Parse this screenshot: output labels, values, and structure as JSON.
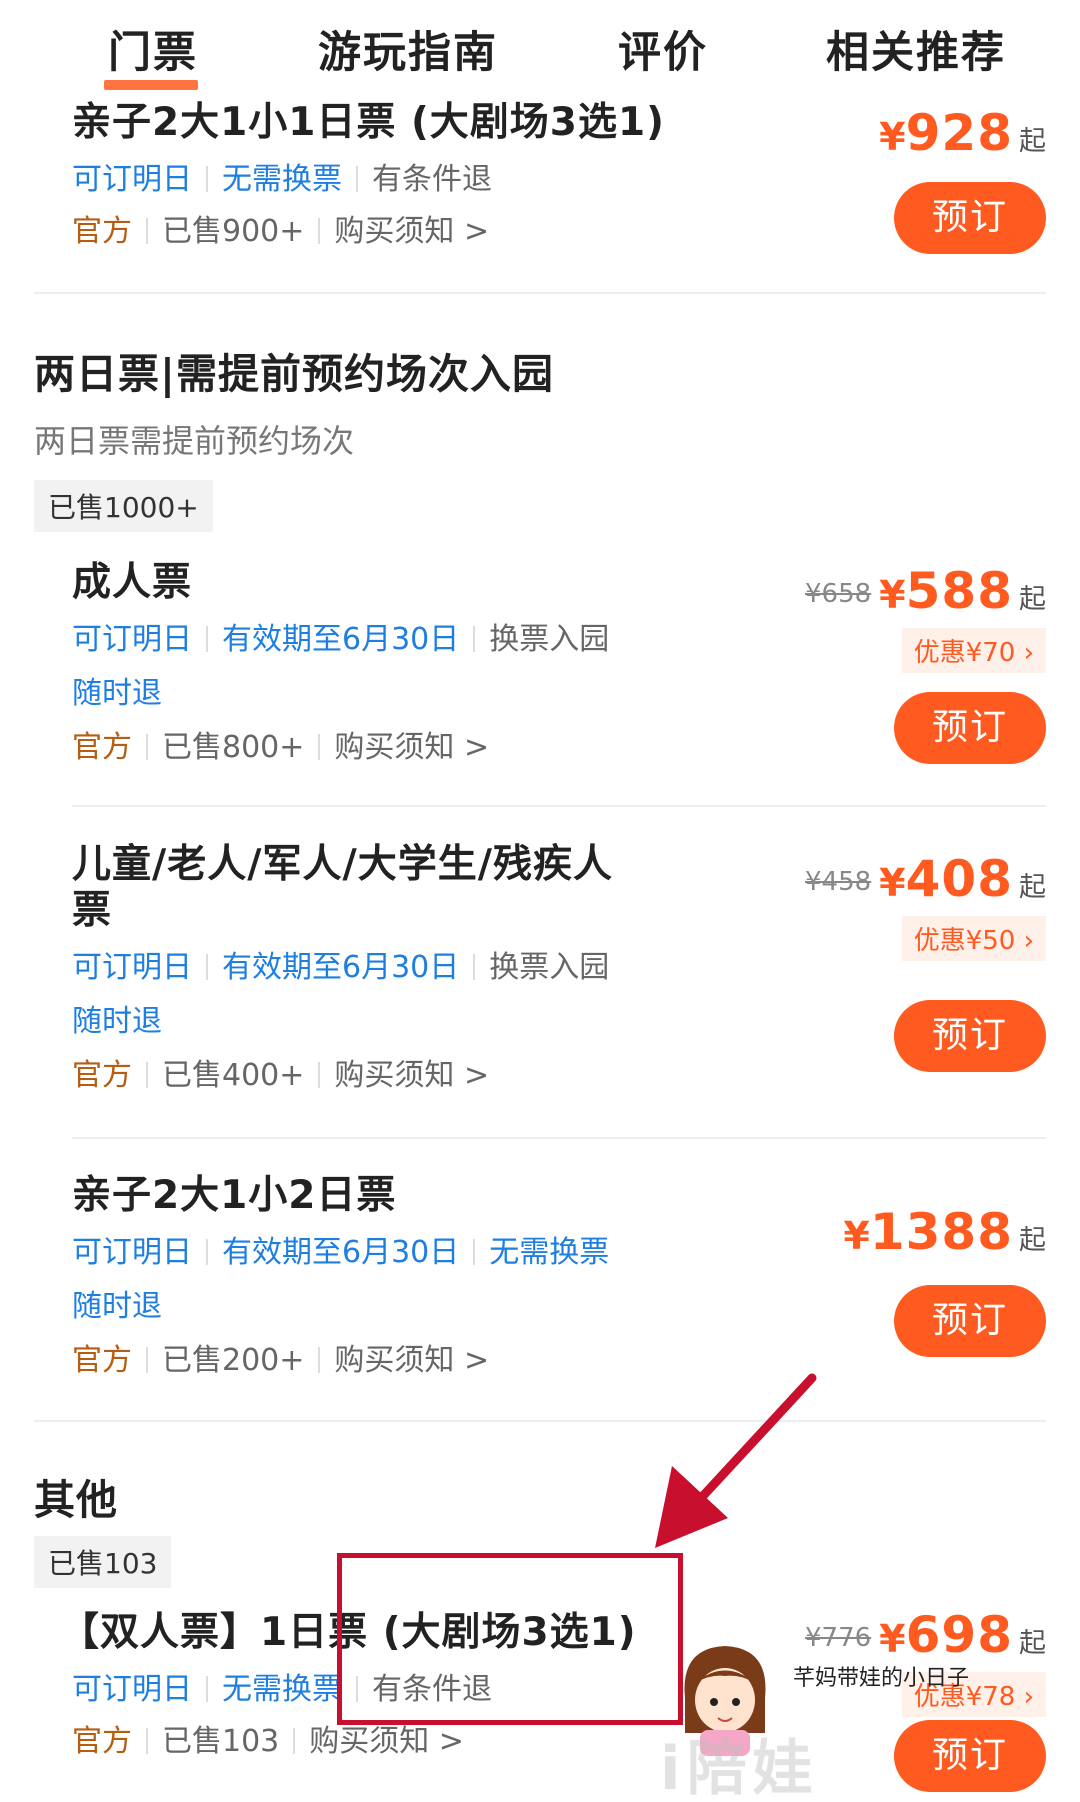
{
  "tabs": [
    {
      "label": "门票",
      "active": true
    },
    {
      "label": "游玩指南",
      "active": false
    },
    {
      "label": "评价",
      "active": false
    },
    {
      "label": "相关推荐",
      "active": false
    }
  ],
  "ticket1": {
    "name": "亲子2大1小1日票 (大剧场3选1)",
    "tags": [
      "可订明日",
      "无需换票",
      "有条件退"
    ],
    "meta": [
      "官方",
      "已售900+",
      "购买须知 >"
    ],
    "currency": "¥",
    "price": "928",
    "price_suffix": "起",
    "button": "预订"
  },
  "group_two_day": {
    "title": "两日票|需提前预约场次入园",
    "subtitle": "两日票需提前预约场次",
    "sold": "已售1000+"
  },
  "ticket2": {
    "name": "成人票",
    "tags": [
      "可订明日",
      "有效期至6月30日",
      "换票入园"
    ],
    "tag_line2": "随时退",
    "meta": [
      "官方",
      "已售800+",
      "购买须知 >"
    ],
    "orig_price": "¥658",
    "currency": "¥",
    "price": "588",
    "price_suffix": "起",
    "discount": "优惠¥70 ›",
    "button": "预订"
  },
  "ticket3": {
    "name_line1": "儿童/老人/军人/大学生/残疾人",
    "name_line2": "票",
    "tags": [
      "可订明日",
      "有效期至6月30日",
      "换票入园"
    ],
    "tag_line2": "随时退",
    "meta": [
      "官方",
      "已售400+",
      "购买须知 >"
    ],
    "orig_price": "¥458",
    "currency": "¥",
    "price": "408",
    "price_suffix": "起",
    "discount": "优惠¥50 ›",
    "button": "预订"
  },
  "ticket4": {
    "name": "亲子2大1小2日票",
    "tags": [
      "可订明日",
      "有效期至6月30日",
      "无需换票"
    ],
    "tag_line2": "随时退",
    "meta": [
      "官方",
      "已售200+",
      "购买须知 >"
    ],
    "currency": "¥",
    "price": "1388",
    "price_suffix": "起",
    "button": "预订"
  },
  "group_other": {
    "title": "其他",
    "sold": "已售103"
  },
  "ticket5": {
    "name": "【双人票】1日票 (大剧场3选1)",
    "tags": [
      "可订明日",
      "无需换票",
      "有条件退"
    ],
    "meta": [
      "官方",
      "已售103",
      "购买须知 >"
    ],
    "orig_price": "¥776",
    "currency": "¥",
    "price": "698",
    "price_suffix": "起",
    "discount": "优惠¥78 ›",
    "button": "预订"
  },
  "watermark": {
    "caption": "芊妈带娃的小日子",
    "logo": "i陪娃"
  },
  "colors": {
    "accent": "#ff5a1f",
    "tag_blue": "#1f7fe0",
    "official_brown": "#b65d12",
    "annotation_red": "#c8102e"
  }
}
